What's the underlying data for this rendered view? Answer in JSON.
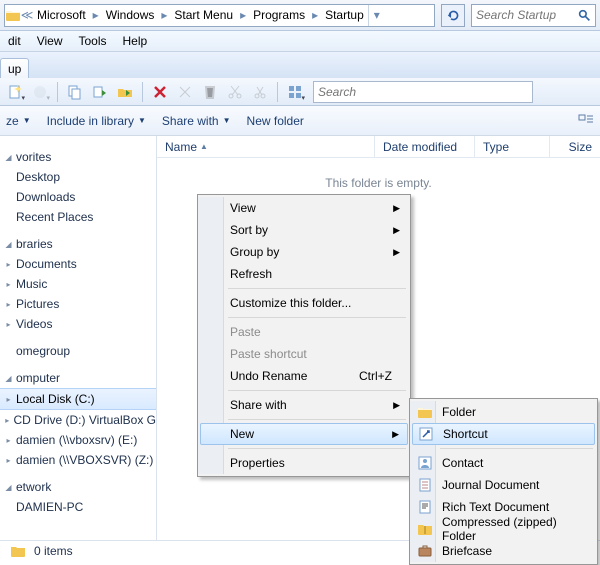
{
  "breadcrumbs": [
    "Microsoft",
    "Windows",
    "Start Menu",
    "Programs",
    "Startup"
  ],
  "search_placeholder": "Search Startup",
  "menubar": [
    "dit",
    "View",
    "Tools",
    "Help"
  ],
  "tab_label": "up",
  "toolbar_search_placeholder": "Search",
  "cmdbar": {
    "organize": "ze",
    "include": "Include in library",
    "share": "Share with",
    "newfolder": "New folder"
  },
  "sidebar": [
    {
      "group": "vorites",
      "items": [
        "Desktop",
        "Downloads",
        "Recent Places"
      ]
    },
    {
      "group": "braries",
      "items": [
        "Documents",
        "Music",
        "Pictures",
        "Videos"
      ]
    },
    {
      "group": "omegroup",
      "items": []
    },
    {
      "group": "omputer",
      "items": [
        "Local Disk (C:)",
        "CD Drive (D:) VirtualBox G",
        "damien (\\\\vboxsrv) (E:)",
        "damien (\\\\VBOXSVR) (Z:)"
      ]
    },
    {
      "group": "etwork",
      "items": [
        "DAMIEN-PC"
      ]
    }
  ],
  "columns": [
    "Name",
    "Date modified",
    "Type",
    "Size"
  ],
  "empty_text": "This folder is empty.",
  "status_text": "0 items",
  "context_menu": [
    {
      "label": "View",
      "sub": true
    },
    {
      "label": "Sort by",
      "sub": true
    },
    {
      "label": "Group by",
      "sub": true
    },
    {
      "label": "Refresh"
    },
    {
      "sep": true
    },
    {
      "label": "Customize this folder..."
    },
    {
      "sep": true
    },
    {
      "label": "Paste",
      "disabled": true
    },
    {
      "label": "Paste shortcut",
      "disabled": true
    },
    {
      "label": "Undo Rename",
      "shortcut": "Ctrl+Z"
    },
    {
      "sep": true
    },
    {
      "label": "Share with",
      "sub": true
    },
    {
      "sep": true
    },
    {
      "label": "New",
      "sub": true,
      "hov": true
    },
    {
      "sep": true
    },
    {
      "label": "Properties"
    }
  ],
  "submenu_new": [
    {
      "label": "Folder",
      "icon": "folder"
    },
    {
      "label": "Shortcut",
      "icon": "shortcut",
      "hov": true
    },
    {
      "sep": true
    },
    {
      "label": "Contact",
      "icon": "contact"
    },
    {
      "label": "Journal Document",
      "icon": "journal"
    },
    {
      "label": "Rich Text Document",
      "icon": "rtf"
    },
    {
      "label": "Compressed (zipped) Folder",
      "icon": "zip"
    },
    {
      "label": "Briefcase",
      "icon": "briefcase"
    }
  ]
}
